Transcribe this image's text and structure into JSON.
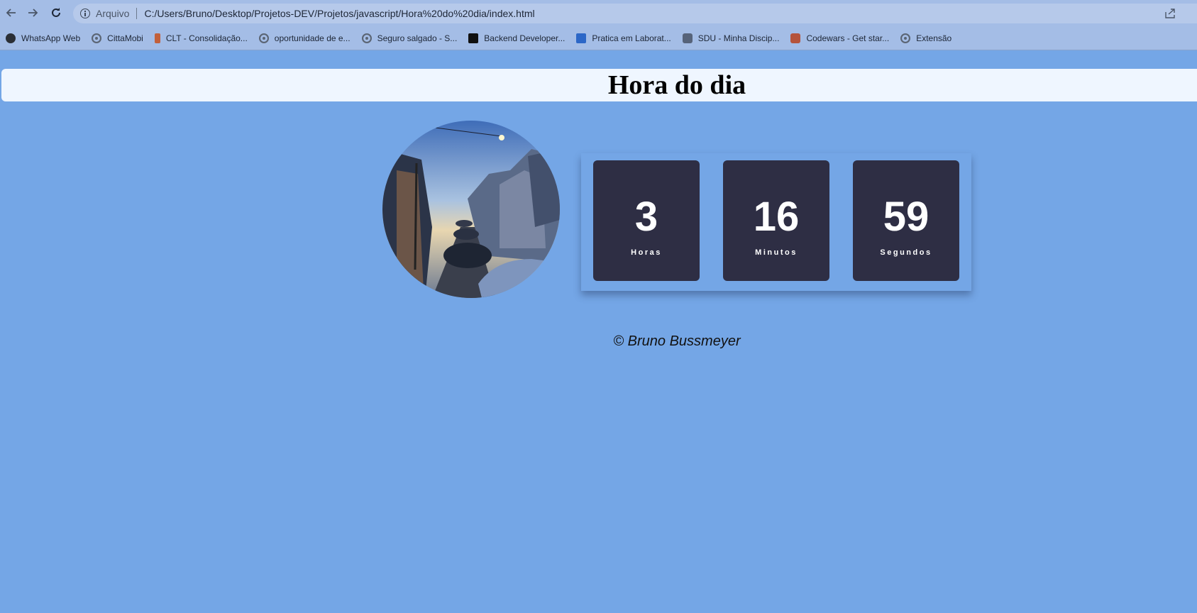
{
  "browser": {
    "scheme_label": "Arquivo",
    "url": "C:/Users/Bruno/Desktop/Projetos-DEV/Projetos/javascript/Hora%20do%20dia/index.html",
    "bookmarks": [
      {
        "label": "WhatsApp Web",
        "icon": "whatsapp-icon"
      },
      {
        "label": "CittaMobi",
        "icon": "globe-icon"
      },
      {
        "label": "CLT - Consolidação...",
        "icon": "clt-icon"
      },
      {
        "label": "oportunidade de e...",
        "icon": "globe-icon"
      },
      {
        "label": "Seguro salgado - S...",
        "icon": "globe-icon"
      },
      {
        "label": "Backend Developer...",
        "icon": "backend-icon"
      },
      {
        "label": "Pratica em Laborat...",
        "icon": "classroom-icon"
      },
      {
        "label": "SDU - Minha Discip...",
        "icon": "sdu-icon"
      },
      {
        "label": "Codewars - Get star...",
        "icon": "codewars-icon"
      },
      {
        "label": "Extensão",
        "icon": "globe-icon"
      }
    ]
  },
  "page": {
    "title": "Hora do dia",
    "clock": {
      "hours": {
        "value": "3",
        "label": "Horas"
      },
      "minutes": {
        "value": "16",
        "label": "Minutos"
      },
      "seconds": {
        "value": "59",
        "label": "Segundos"
      }
    },
    "footer": "© Bruno Bussmeyer"
  },
  "colors": {
    "background": "#74a6e6",
    "header_bar": "#eff6ff",
    "clock_tile": "#2e2e44"
  }
}
